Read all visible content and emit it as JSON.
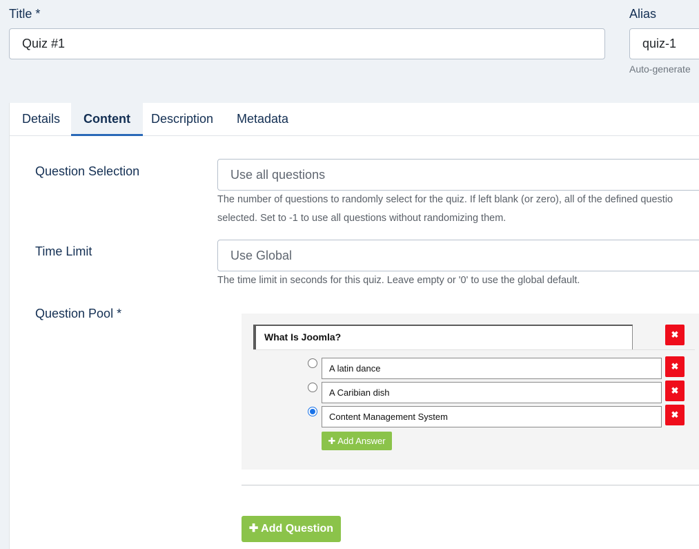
{
  "title": {
    "label": "Title *",
    "value": "Quiz #1"
  },
  "alias": {
    "label": "Alias",
    "value": "quiz-1",
    "help": "Auto-generate"
  },
  "tabs": [
    {
      "label": "Details"
    },
    {
      "label": "Content"
    },
    {
      "label": "Description"
    },
    {
      "label": "Metadata"
    }
  ],
  "active_tab": "Content",
  "question_selection": {
    "label": "Question Selection",
    "placeholder": "Use all questions",
    "help_line1": "The number of questions to randomly select for the quiz. If left blank (or zero), all of the defined questio",
    "help_line2": "selected. Set to -1 to use all questions without randomizing them."
  },
  "time_limit": {
    "label": "Time Limit",
    "placeholder": "Use Global",
    "help": "The time limit in seconds for this quiz. Leave empty or '0' to use the global default."
  },
  "question_pool": {
    "label": "Question Pool *",
    "question": "What Is Joomla?",
    "answers": [
      {
        "text": "A latin dance",
        "correct": false
      },
      {
        "text": "A Caribian dish",
        "correct": false
      },
      {
        "text": "Content Management System",
        "correct": true
      }
    ],
    "delete_glyph": "✖",
    "add_answer_label": "✚ Add Answer",
    "add_question_label": "✚ Add Question"
  },
  "colors": {
    "accent": "#2a69b8",
    "delete": "#ef0d1b",
    "add": "#8bc34a",
    "label": "#132f53"
  }
}
